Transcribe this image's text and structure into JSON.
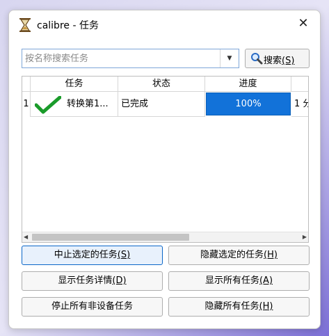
{
  "window": {
    "title": "calibre - 任务",
    "close_label": "✕"
  },
  "search": {
    "placeholder": "按名称搜索任务",
    "value": "",
    "button_label": "搜索",
    "button_mnemonic": "(S)"
  },
  "table": {
    "columns": [
      "任务",
      "状态",
      "进度"
    ],
    "rows": [
      {
        "index": "1",
        "task": "转换第1...",
        "status": "已完成",
        "progress_pct": 100,
        "progress_text": "100%",
        "eta": "1 分"
      }
    ]
  },
  "buttons": {
    "stop_selected": {
      "label": "中止选定的任务",
      "mnemonic": "(S)"
    },
    "hide_selected": {
      "label": "隐藏选定的任务",
      "mnemonic": "(H)"
    },
    "show_details": {
      "label": "显示任务详情",
      "mnemonic": "(D)"
    },
    "show_all": {
      "label": "显示所有任务",
      "mnemonic": "(A)"
    },
    "stop_all_non_device": {
      "label": "停止所有非设备任务"
    },
    "hide_all": {
      "label": "隐藏所有任务",
      "mnemonic": "(H)"
    }
  },
  "colors": {
    "accent": "#1272d9",
    "check": "#1a9b2a"
  },
  "icons": {
    "app": "hourglass-icon",
    "search": "magnifier-icon",
    "done": "checkmark-icon"
  }
}
